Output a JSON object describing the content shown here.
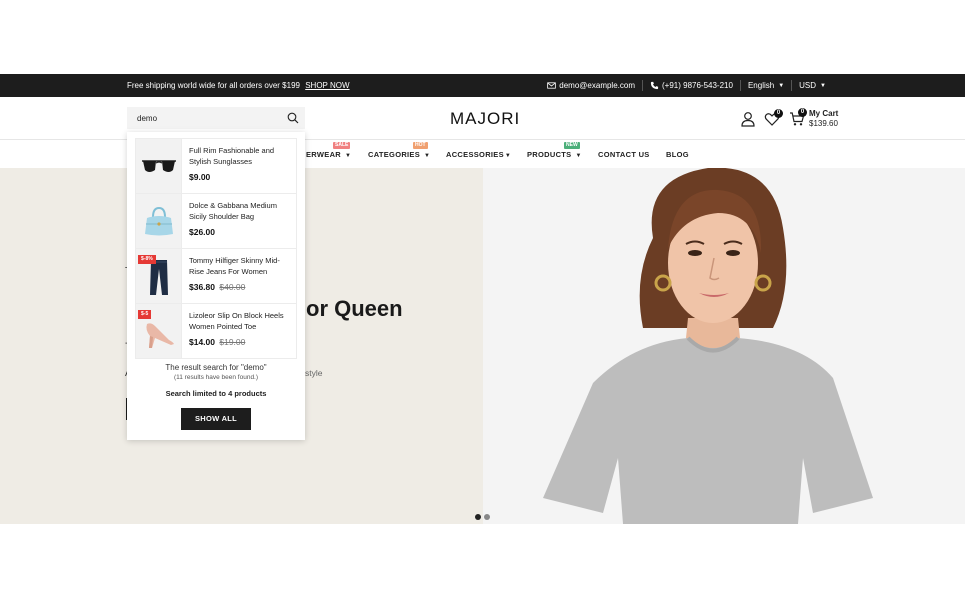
{
  "topbar": {
    "promo_text": "Free shipping world wide for all orders over $199",
    "promo_link": "SHOP NOW",
    "email": "demo@example.com",
    "phone": "(+91) 9876-543-210",
    "language": "English",
    "currency": "USD"
  },
  "header": {
    "search_value": "demo",
    "logo": "MAJORI",
    "wishlist_count": "0",
    "cart_count": "0",
    "cart_label": "My Cart",
    "cart_total": "$139.60"
  },
  "nav": {
    "items": [
      {
        "label": "ERWEAR",
        "tag": "SALE",
        "tag_color": "#f08080"
      },
      {
        "label": "CATEGORIES",
        "tag": "HOT",
        "tag_color": "#f0a070"
      },
      {
        "label": "ACCESSORIES"
      },
      {
        "label": "PRODUCTS",
        "tag": "NEW",
        "tag_color": "#4caf7a"
      },
      {
        "label": "CONTACT US"
      },
      {
        "label": "BLOG"
      }
    ]
  },
  "hero": {
    "headline_fragment": "or Queen",
    "sub_fragment": "style",
    "frag_1": "T",
    "frag_2": "-",
    "frag_3": "A"
  },
  "search_results": {
    "items": [
      {
        "name": "Full Rim Fashionable and Stylish Sunglasses",
        "price": "$9.00",
        "old_price": "",
        "discount": "",
        "icon": "sunglasses-icon"
      },
      {
        "name": "Dolce & Gabbana Medium Sicily Shoulder Bag",
        "price": "$26.00",
        "old_price": "",
        "discount": "",
        "icon": "bag-icon"
      },
      {
        "name": "Tommy Hilfiger Skinny Mid-Rise Jeans For Women",
        "price": "$36.80",
        "old_price": "$40.00",
        "discount": "$-8%",
        "icon": "jeans-icon"
      },
      {
        "name": "Lizoleor Slip On Block Heels Women Pointed Toe",
        "price": "$14.00",
        "old_price": "$19.00",
        "discount": "$-5",
        "icon": "heels-icon"
      }
    ],
    "result_line": "The result search for \"demo\"",
    "count_line": "(11 results have been found.)",
    "limit_line": "Search limited to 4 products",
    "show_all": "SHOW ALL"
  },
  "carousel": {
    "active_index": 0,
    "count": 2
  }
}
